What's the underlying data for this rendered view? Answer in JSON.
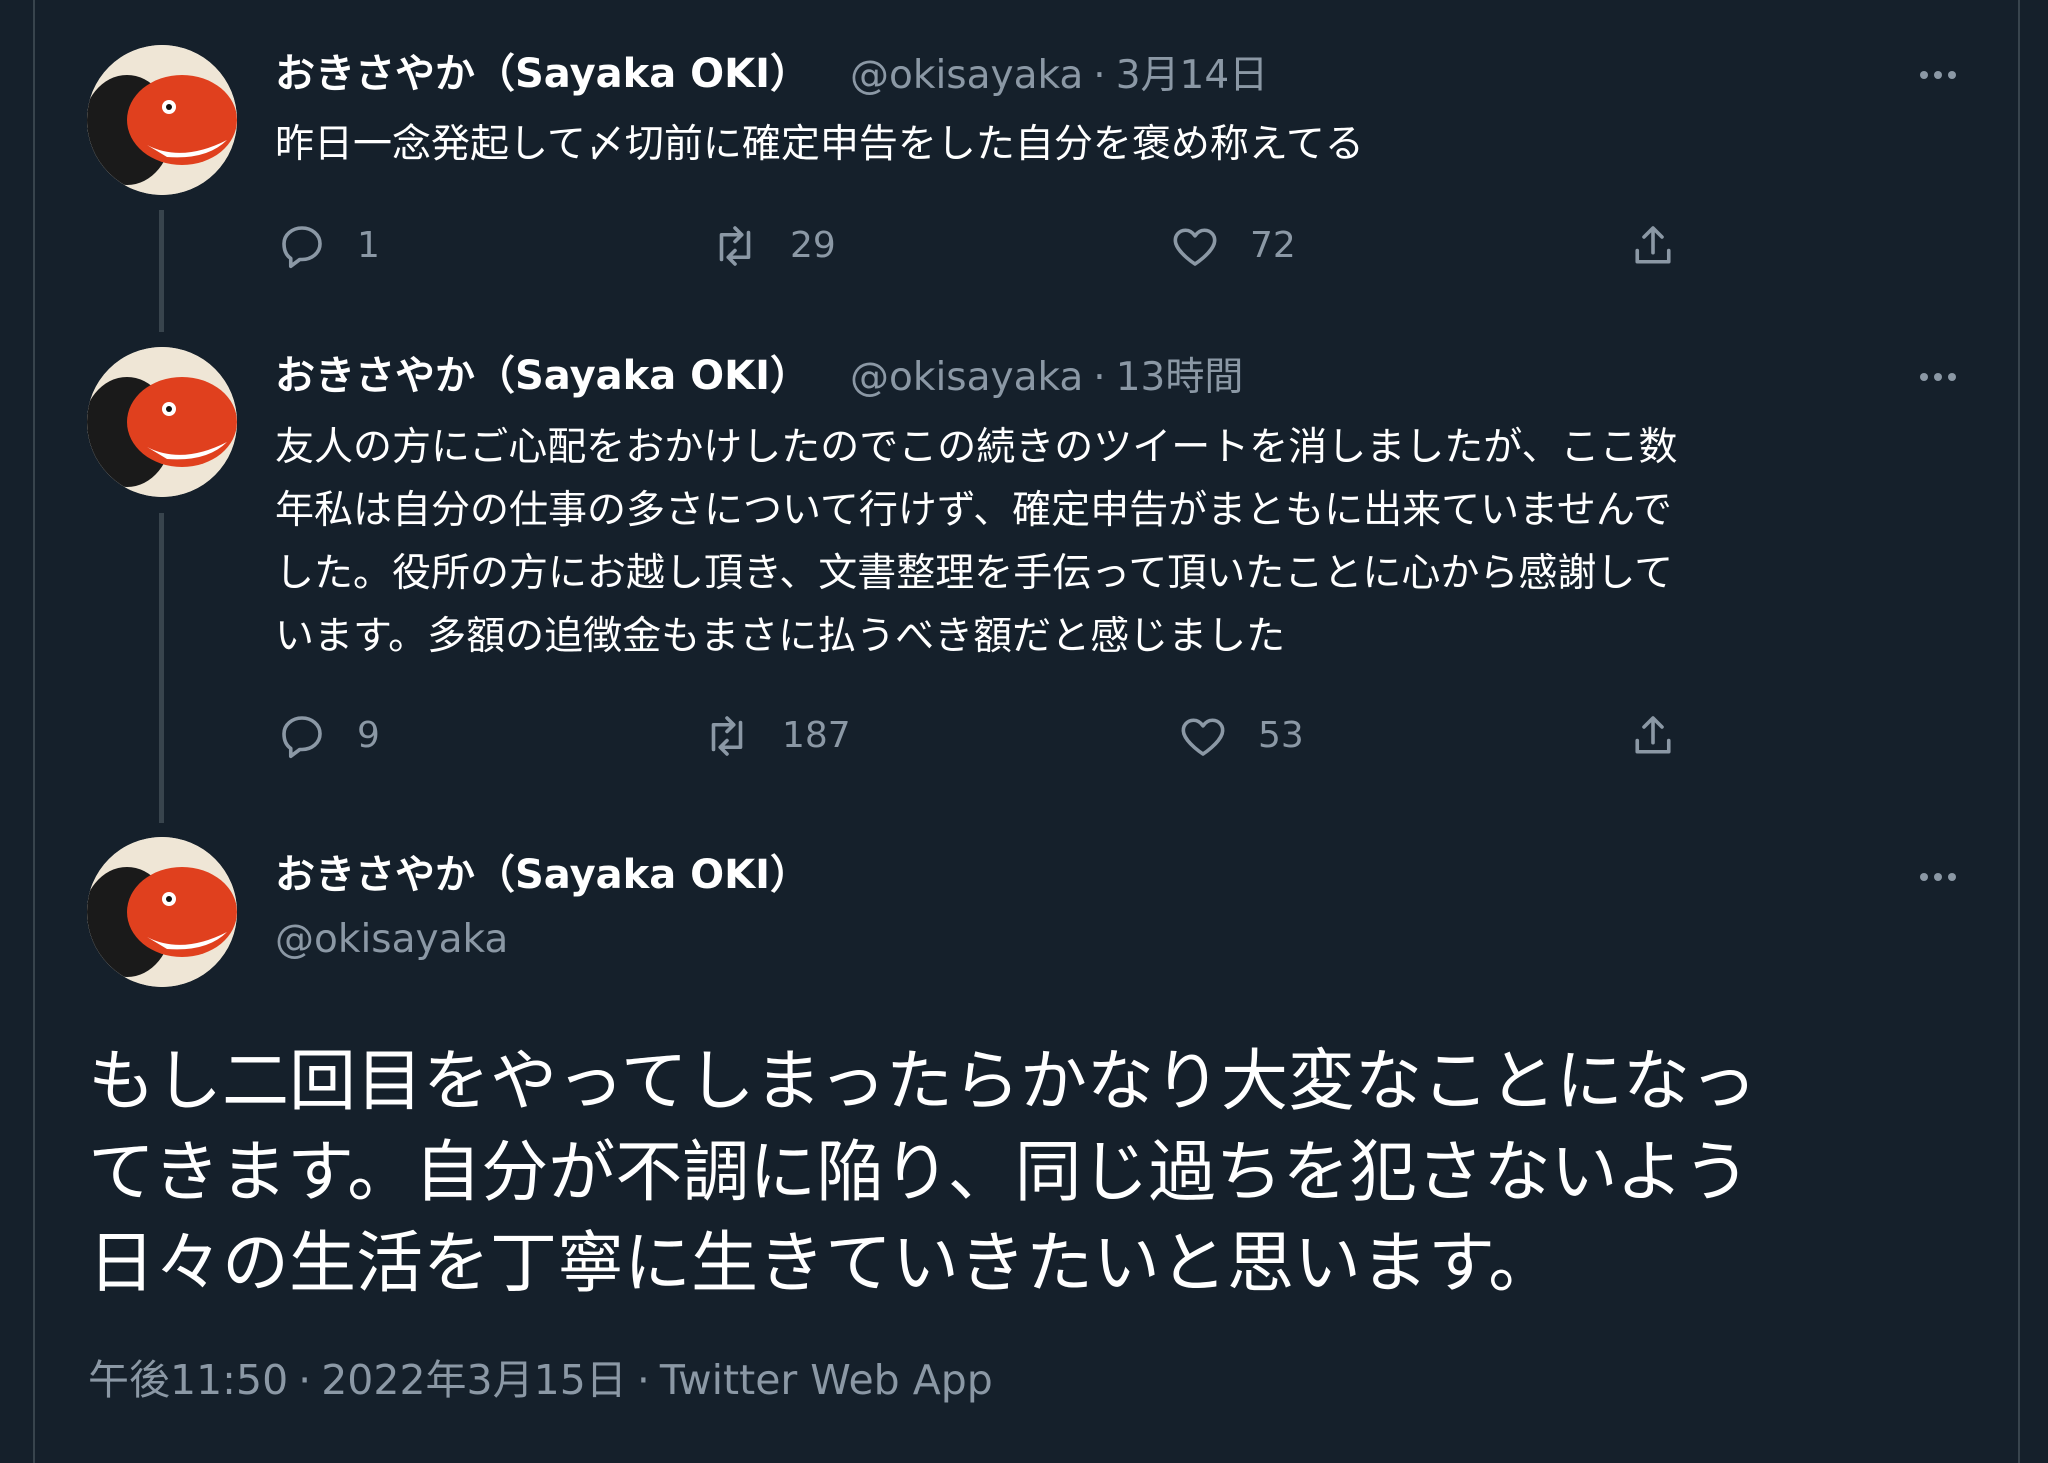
{
  "colors": {
    "background": "#15202b",
    "border": "#38444d",
    "text_primary": "#ffffff",
    "text_secondary": "#8b98a5"
  },
  "tweets": [
    {
      "display_name": "おきさやか（Sayaka OKI）",
      "handle": "@okisayaka",
      "separator": "·",
      "time": "3月14日",
      "text": "昨日一念発起して〆切前に確定申告をした自分を褒め称えてる",
      "replies": "1",
      "retweets": "29",
      "likes": "72"
    },
    {
      "display_name": "おきさやか（Sayaka OKI）",
      "handle": "@okisayaka",
      "separator": "·",
      "time": "13時間",
      "text_lines": [
        "友人の方にご心配をおかけしたのでこの続きのツイートを消しましたが、ここ数",
        "年私は自分の仕事の多さについて行けず、確定申告がまともに出来ていませんで",
        "した。役所の方にお越し頂き、文書整理を手伝って頂いたことに心から感謝して",
        "います。多額の追徴金もまさに払うべき額だと感じました"
      ],
      "replies": "9",
      "retweets": "187",
      "likes": "53"
    }
  ],
  "main_tweet": {
    "display_name": "おきさやか（Sayaka OKI）",
    "handle": "@okisayaka",
    "text_lines": [
      "もし二回目をやってしまったらかなり大変なことになっ",
      "てきます。自分が不調に陥り、同じ過ちを犯さないよう",
      "日々の生活を丁寧に生きていきたいと思います。"
    ],
    "time": "午後11:50",
    "separator": "·",
    "date": "2022年3月15日",
    "source": "Twitter Web App"
  },
  "icons": {
    "reply": "reply-bubble-icon",
    "retweet": "retweet-arrows-icon",
    "like": "heart-icon",
    "share": "share-upload-icon",
    "more": "more-dots-icon"
  }
}
